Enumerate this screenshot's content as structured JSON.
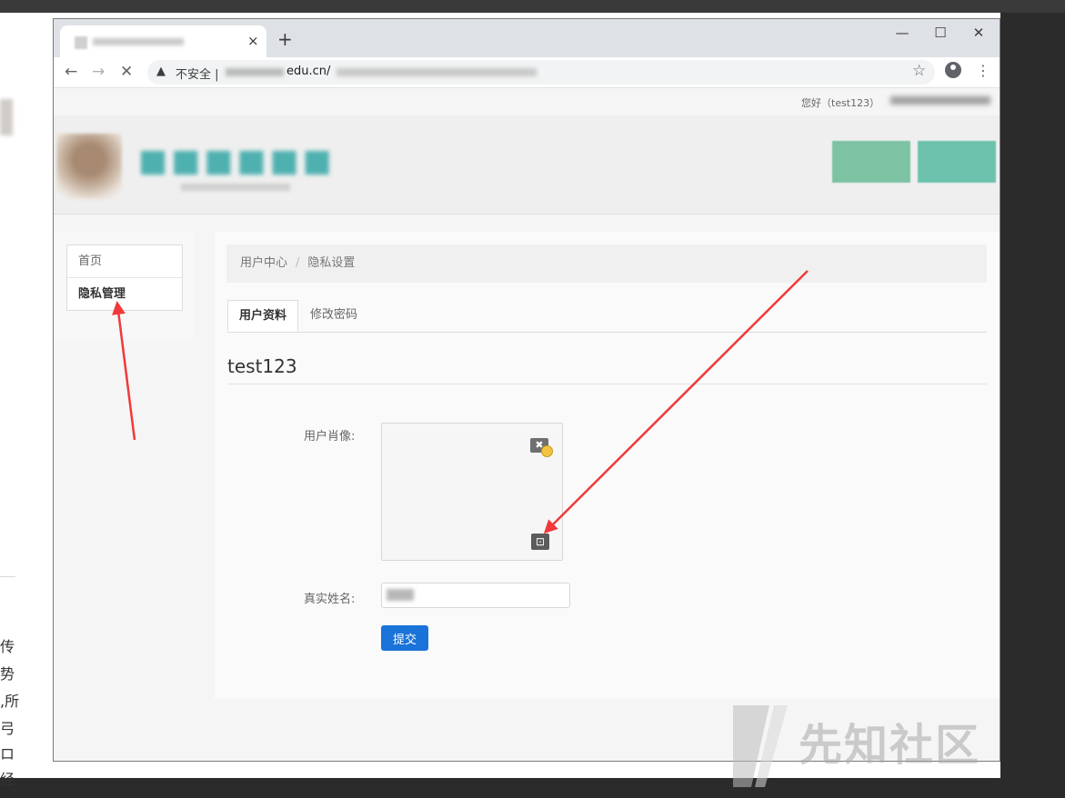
{
  "background_document": {
    "side_chars": [
      "传",
      "势",
      ",所",
      "弓",
      "ロ",
      "经"
    ]
  },
  "browser": {
    "new_tab_symbol": "+",
    "tab_close_symbol": "×",
    "window_controls": {
      "minimize": "—",
      "maximize": "☐",
      "close": "✕"
    },
    "nav": {
      "back": "←",
      "forward": "→",
      "stop": "✕"
    },
    "address": {
      "security_label": "不安全 |",
      "url_visible": "edu.cn/"
    }
  },
  "page": {
    "greeting": "您好（test123）",
    "sidebar": {
      "items": [
        {
          "label": "首页",
          "active": false
        },
        {
          "label": "隐私管理",
          "active": true
        }
      ]
    },
    "breadcrumb": {
      "items": [
        "用户中心",
        "隐私设置"
      ],
      "separator": "/"
    },
    "tabs": [
      {
        "label": "用户资料",
        "active": true
      },
      {
        "label": "修改密码",
        "active": false
      }
    ],
    "username": "test123",
    "form": {
      "avatar_label": "用户肖像:",
      "realname_label": "真实姓名:",
      "submit_label": "提交"
    }
  },
  "watermark": {
    "text": "先知社区"
  },
  "colors": {
    "accent_red": "#f0393a",
    "submit_blue": "#1a73d9",
    "header_button_green": "#7cc2a3"
  }
}
